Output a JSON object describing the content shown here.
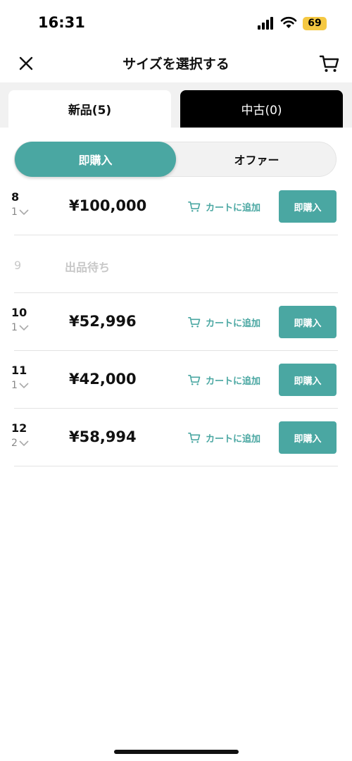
{
  "status": {
    "time": "16:31",
    "battery": "69"
  },
  "nav": {
    "title": "サイズを選択する"
  },
  "tabs": {
    "new_label": "新品(5)",
    "used_label": "中古(0)"
  },
  "segment": {
    "buy_now": "即購入",
    "offer": "オファー"
  },
  "rows": [
    {
      "size": "8",
      "qty": "1",
      "price": "¥100,000",
      "cart": "カートに追加",
      "buy": "即購入"
    },
    {
      "size": "9",
      "status": "出品待ち"
    },
    {
      "size": "10",
      "qty": "1",
      "price": "¥52,996",
      "cart": "カートに追加",
      "buy": "即購入"
    },
    {
      "size": "11",
      "qty": "1",
      "price": "¥42,000",
      "cart": "カートに追加",
      "buy": "即購入"
    },
    {
      "size": "12",
      "qty": "2",
      "price": "¥58,994",
      "cart": "カートに追加",
      "buy": "即購入"
    }
  ],
  "colors": {
    "accent": "#4aa7a2",
    "disabled": "#c8c8c8"
  },
  "icons": [
    "signal-icon",
    "wifi-icon",
    "close-icon",
    "cart-icon",
    "chevron-down-icon"
  ]
}
